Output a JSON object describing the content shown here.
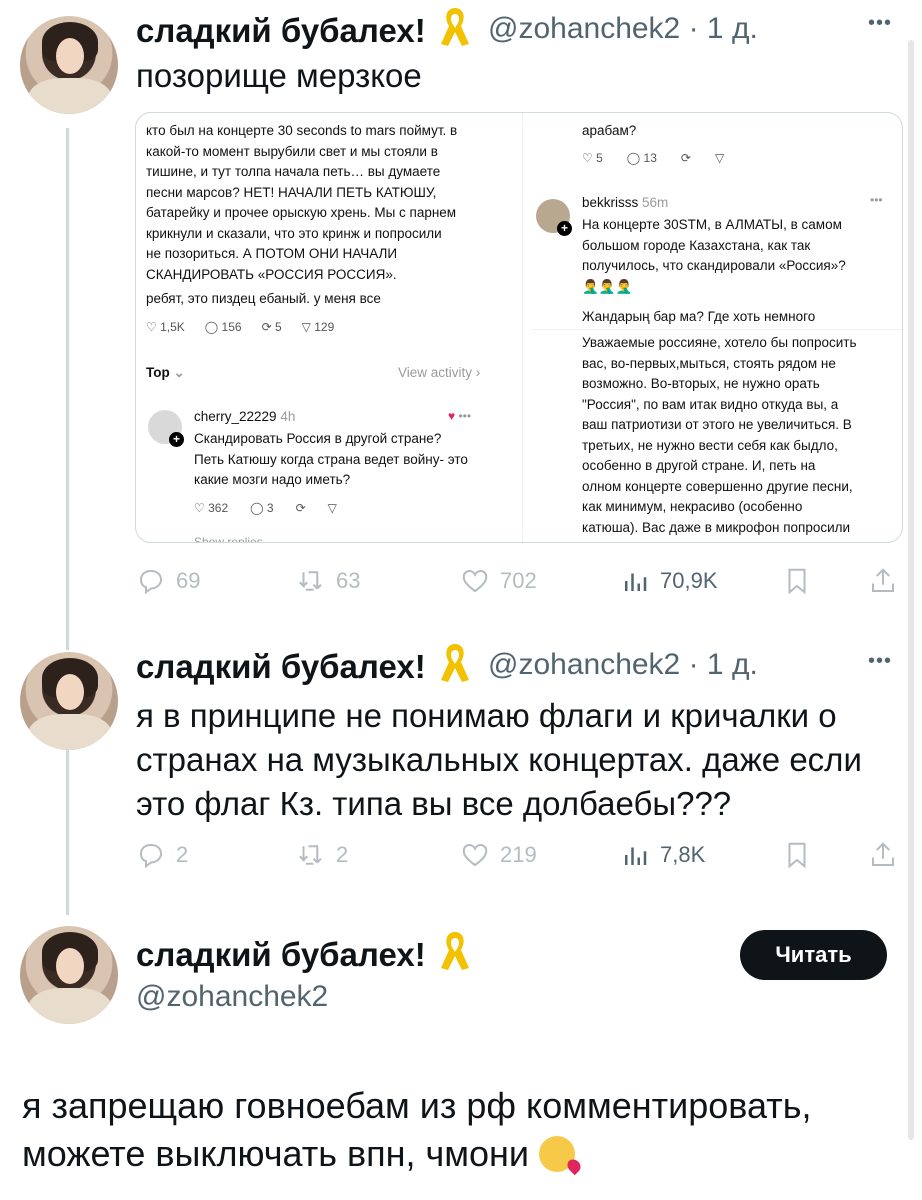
{
  "tweets": [
    {
      "name": "сладкий бубалех!",
      "handle": "@zohanchek2",
      "time": "· 1 д.",
      "text": "позорище мерзкое",
      "stats": {
        "replies": "69",
        "retweets": "63",
        "likes": "702",
        "views": "70,9K"
      }
    },
    {
      "name": "сладкий бубалех!",
      "handle": "@zohanchek2",
      "time": "· 1 д.",
      "text_lines": [
        "я в принципе не понимаю флаги и кричалки о",
        "странах на музыкальных концертах. даже если",
        "это флаг Кз. типа вы все долбаебы???"
      ],
      "stats": {
        "replies": "2",
        "retweets": "2",
        "likes": "219",
        "views": "7,8K"
      }
    }
  ],
  "embed": {
    "left_post_lines": [
      "кто был на концерте 30 seconds to mars поймут. в",
      "какой-то момент вырубили свет и мы стояли в",
      "тишине, и тут толпа начала петь… вы думаете",
      "песни марсов? НЕТ! НАЧАЛИ ПЕТЬ КАТЮШУ,",
      "батарейку и прочее орыскую хрень. Мы с парнем",
      "крикнули и сказали, что это кринж и попросили",
      "не позориться. А ПОТОМ ОНИ НАЧАЛИ",
      "СКАНДИРОВАТЬ «РОССИЯ РОССИЯ»."
    ],
    "left_post_tail": "ребят, это пиздец ебаный. у меня все",
    "left_stats": {
      "likes": "1,5K",
      "comments": "156",
      "reposts": "5",
      "shares": "129"
    },
    "top_label": "Top",
    "view_activity": "View activity",
    "reply_user": "cherry_22229",
    "reply_time": "4h",
    "reply_lines": [
      "Скандировать Россия в другой стране?",
      "Петь Катюшу когда страна ведет войну- это",
      "какие мозги надо иметь?"
    ],
    "reply_stats": {
      "likes": "362",
      "comments": "3"
    },
    "show_replies": "Show replies",
    "right_top_text": "арабам?",
    "right_top_stats": {
      "likes": "5",
      "comments": "13"
    },
    "right_user": "bekkrisss",
    "right_time": "56m",
    "right_lines": [
      "На концерте 30STM, в АЛМАТЫ, в самом",
      "большом городе Казахстана, как так",
      "получилось, что скандировали «Россия»?"
    ],
    "right_emoji": "🤦‍♂️🤦‍♂️🤦‍♂️",
    "right_mid": "Жандарың бар ма? Где хоть немного",
    "right_long_lines": [
      "Уважаемые россияне, хотело бы попросить",
      "вас, во-первых,мыться, стоять рядом не",
      "возможно. Во-вторых, не нужно орать",
      "\"Россия\", по вам итак видно откуда вы, а",
      "ваш патриотизи от этого не увеличиться. В",
      "третьих, не нужно вести себя как быдло,",
      "особенно в другой стране. И, петь на",
      "олном концерте совершенно другие песни,",
      "как минимум, некрасиво (особенно",
      "катюша). Вас даже в микрофон попросили"
    ]
  },
  "profile": {
    "name": "сладкий бубалех!",
    "handle": "@zohanchek2",
    "follow_label": "Читать",
    "bio": "я запрещаю говноебам из рф  комментировать,",
    "bio2": "можете выключать впн, чмони"
  },
  "colors": {
    "text": "#0f1419",
    "muted": "#536471",
    "line": "#cfd9de",
    "ribbon": "#f2c200"
  }
}
